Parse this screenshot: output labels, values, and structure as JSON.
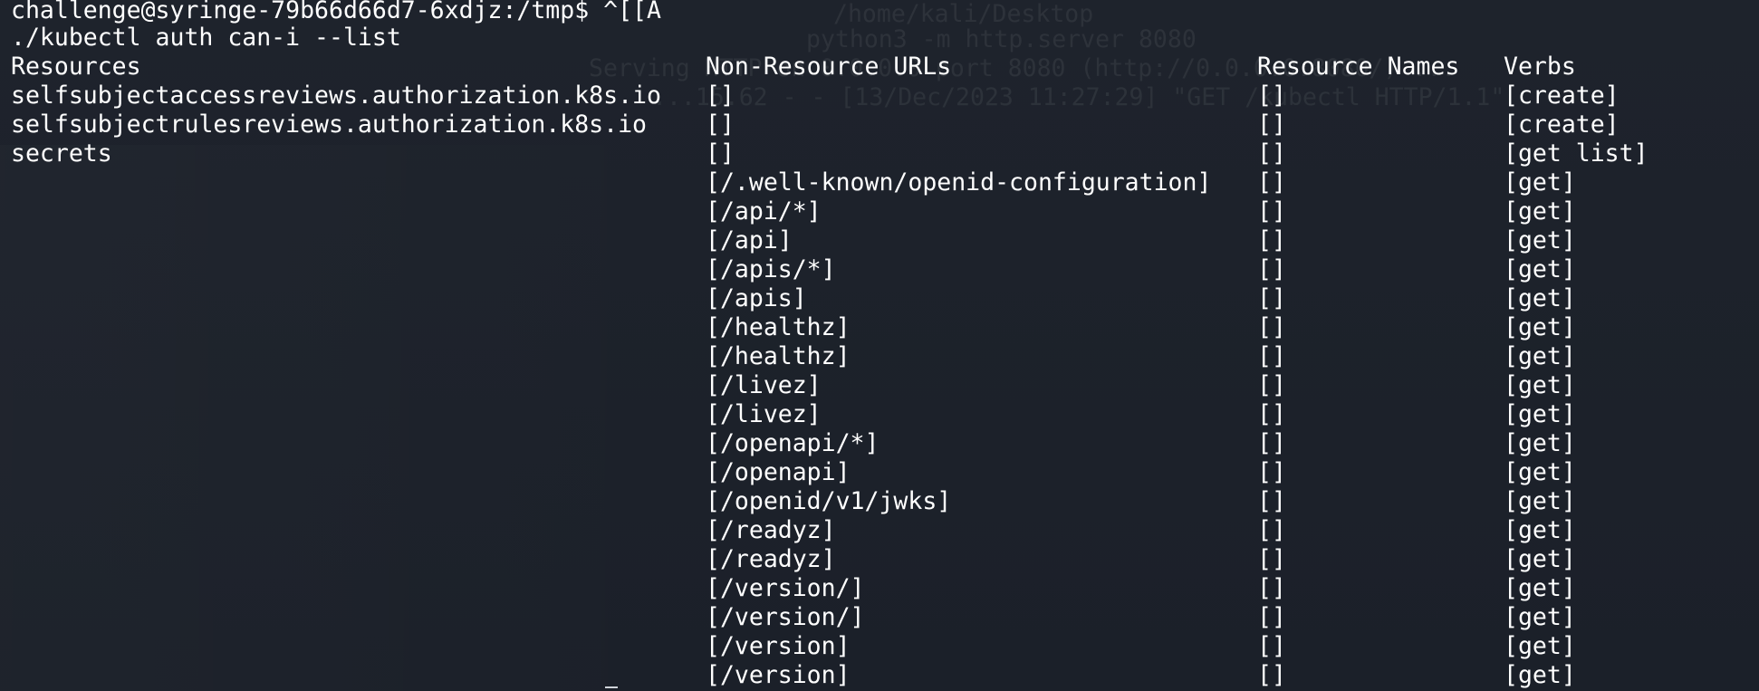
{
  "terminal": {
    "prompt": "challenge@syringe-79b66d66d7-6xdjz:/tmp$ ^[[A",
    "command": "./kubectl auth can-i --list",
    "ghost_lines": [
      "/home/kali/Desktop",
      "python3 -m http.server 8080",
      "Serving HTTP on 0.0.0.0 port 8080 (http://0.0.0.0:8080/) ...",
      "...15.62 - - [13/Dec/2023 11:27:29] \"GET /kubectl HTTP/1.1\""
    ]
  },
  "table": {
    "headers": {
      "resources": "Resources",
      "non_resource_urls": "Non-Resource URLs",
      "resource_names": "Resource Names",
      "verbs": "Verbs"
    },
    "rows": [
      {
        "resource": "selfsubjectaccessreviews.authorization.k8s.io",
        "url": "[]",
        "names": "[]",
        "verbs": "[create]"
      },
      {
        "resource": "selfsubjectrulesreviews.authorization.k8s.io",
        "url": "[]",
        "names": "[]",
        "verbs": "[create]"
      },
      {
        "resource": "secrets",
        "url": "[]",
        "names": "[]",
        "verbs": "[get list]"
      },
      {
        "resource": "",
        "url": "[/.well-known/openid-configuration]",
        "names": "[]",
        "verbs": "[get]"
      },
      {
        "resource": "",
        "url": "[/api/*]",
        "names": "[]",
        "verbs": "[get]"
      },
      {
        "resource": "",
        "url": "[/api]",
        "names": "[]",
        "verbs": "[get]"
      },
      {
        "resource": "",
        "url": "[/apis/*]",
        "names": "[]",
        "verbs": "[get]"
      },
      {
        "resource": "",
        "url": "[/apis]",
        "names": "[]",
        "verbs": "[get]"
      },
      {
        "resource": "",
        "url": "[/healthz]",
        "names": "[]",
        "verbs": "[get]"
      },
      {
        "resource": "",
        "url": "[/healthz]",
        "names": "[]",
        "verbs": "[get]"
      },
      {
        "resource": "",
        "url": "[/livez]",
        "names": "[]",
        "verbs": "[get]"
      },
      {
        "resource": "",
        "url": "[/livez]",
        "names": "[]",
        "verbs": "[get]"
      },
      {
        "resource": "",
        "url": "[/openapi/*]",
        "names": "[]",
        "verbs": "[get]"
      },
      {
        "resource": "",
        "url": "[/openapi]",
        "names": "[]",
        "verbs": "[get]"
      },
      {
        "resource": "",
        "url": "[/openid/v1/jwks]",
        "names": "[]",
        "verbs": "[get]"
      },
      {
        "resource": "",
        "url": "[/readyz]",
        "names": "[]",
        "verbs": "[get]"
      },
      {
        "resource": "",
        "url": "[/readyz]",
        "names": "[]",
        "verbs": "[get]"
      },
      {
        "resource": "",
        "url": "[/version/]",
        "names": "[]",
        "verbs": "[get]"
      },
      {
        "resource": "",
        "url": "[/version/]",
        "names": "[]",
        "verbs": "[get]"
      },
      {
        "resource": "",
        "url": "[/version]",
        "names": "[]",
        "verbs": "[get]"
      },
      {
        "resource": "",
        "url": "[/version]",
        "names": "[]",
        "verbs": "[get]"
      }
    ]
  },
  "colors": {
    "background": "#1d222b",
    "text": "#ffffff"
  }
}
